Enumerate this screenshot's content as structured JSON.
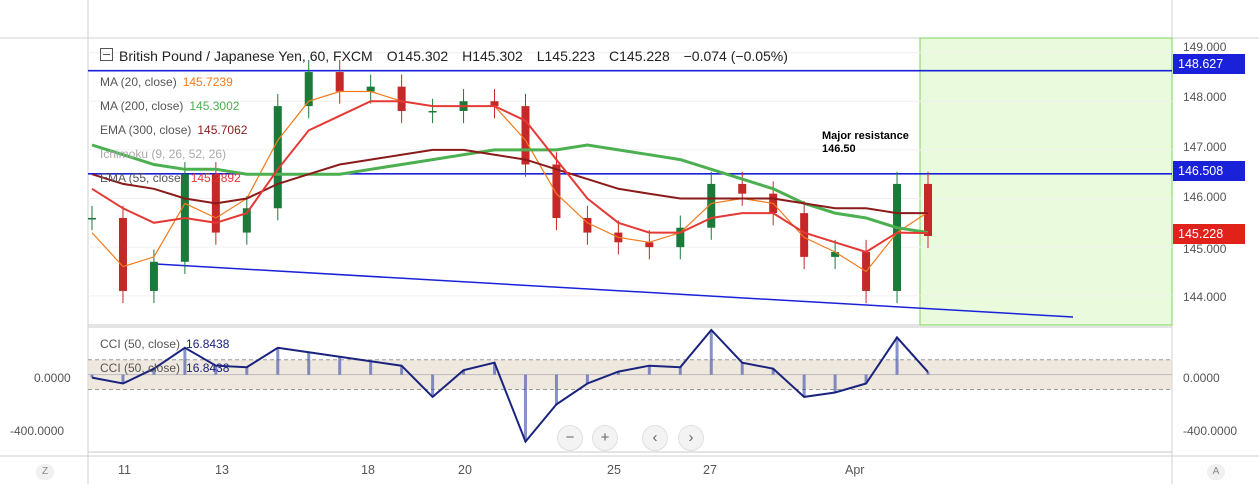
{
  "header": {
    "symbol": "British Pound / Japanese Yen, 60, FXCM",
    "open": "O145.302",
    "high": "H145.302",
    "low": "L145.223",
    "close": "C145.228",
    "change": "−0.074 (−0.05%)"
  },
  "indicators": [
    {
      "label": "MA (20, close)",
      "value": "145.7239",
      "color": "#f07b1c"
    },
    {
      "label": "MA (200, close)",
      "value": "145.3002",
      "color": "#4caf50"
    },
    {
      "label": "EMA (300, close)",
      "value": "145.7062",
      "color": "#8b1a1a"
    },
    {
      "label": "Ichimoku (9, 26, 52, 26)",
      "value": "",
      "color": "#aaaaaa"
    },
    {
      "label": "EMA (55, close)",
      "value": "145.2892",
      "color": "#e53935"
    }
  ],
  "cci_indicators": [
    {
      "label": "CCI (50, close)",
      "value": "16.8438",
      "color": "#1a237e"
    },
    {
      "label": "CCI (50, close)",
      "value": "16.8438",
      "color": "#1a237e"
    }
  ],
  "price_tags": {
    "upper": "148.627",
    "resistance": "146.508",
    "last": "145.228"
  },
  "annotation": {
    "line1": "Major resistance",
    "line2": "146.50"
  },
  "axis": {
    "price_ticks": [
      "149.000",
      "148.000",
      "147.000",
      "146.000",
      "145.000",
      "144.000"
    ],
    "cci_ticks": [
      "0.0000",
      "-400.0000"
    ],
    "dates": [
      "11",
      "13",
      "18",
      "20",
      "25",
      "27",
      "Apr"
    ]
  },
  "controls": {
    "zoom_out": "−",
    "zoom_in": "+",
    "scroll_left": "‹",
    "scroll_right": "›",
    "left_corner": "Z",
    "right_corner": "A"
  },
  "colors": {
    "up": "#1b7a3a",
    "down": "#c62828",
    "blue_line": "#1a22d9",
    "forecast_zone": "#e9fbdc",
    "cci_band": "#e8ded0"
  },
  "chart_data": {
    "type": "line",
    "title": "British Pound / Japanese Yen, 60, FXCM",
    "x": [
      "11",
      "11.5",
      "12",
      "12.5",
      "13",
      "13.5",
      "14",
      "14.5",
      "15",
      "18",
      "18.5",
      "19",
      "19.5",
      "20",
      "20.5",
      "21",
      "22",
      "25",
      "25.5",
      "26",
      "26.5",
      "27",
      "27.5",
      "28",
      "28.5",
      "29",
      "Apr 1",
      "Apr 1.5"
    ],
    "series": [
      {
        "name": "Price (close)",
        "values": [
          145.6,
          144.1,
          144.7,
          146.5,
          145.3,
          145.8,
          147.9,
          148.6,
          148.2,
          148.3,
          147.8,
          147.8,
          148.0,
          147.9,
          146.7,
          145.6,
          145.3,
          145.1,
          145.0,
          145.4,
          146.3,
          146.1,
          145.7,
          144.8,
          144.9,
          144.1,
          146.3,
          145.23
        ]
      },
      {
        "name": "MA (20, close)",
        "values": [
          145.3,
          144.6,
          144.8,
          145.9,
          145.6,
          146.0,
          147.2,
          148.0,
          148.2,
          148.2,
          148.0,
          147.9,
          147.9,
          147.9,
          147.2,
          146.1,
          145.5,
          145.2,
          145.1,
          145.3,
          145.9,
          146.0,
          145.9,
          145.2,
          144.9,
          144.5,
          145.3,
          145.72
        ]
      },
      {
        "name": "MA (200, close)",
        "values": [
          147.1,
          146.9,
          146.7,
          146.6,
          146.6,
          146.5,
          146.5,
          146.5,
          146.5,
          146.6,
          146.7,
          146.8,
          146.9,
          147.0,
          147.0,
          147.0,
          147.1,
          147.0,
          146.9,
          146.8,
          146.6,
          146.4,
          146.2,
          145.9,
          145.7,
          145.6,
          145.4,
          145.3
        ]
      },
      {
        "name": "EMA (300, close)",
        "values": [
          146.5,
          146.3,
          146.2,
          146.0,
          145.9,
          146.0,
          146.3,
          146.5,
          146.7,
          146.8,
          146.9,
          147.0,
          147.0,
          146.9,
          146.8,
          146.6,
          146.4,
          146.2,
          146.1,
          146.0,
          146.0,
          146.0,
          146.0,
          145.9,
          145.8,
          145.8,
          145.7,
          145.7
        ]
      },
      {
        "name": "EMA (55, close)",
        "values": [
          146.2,
          145.8,
          145.5,
          145.6,
          145.5,
          145.7,
          146.6,
          147.4,
          147.7,
          148.0,
          148.0,
          147.9,
          147.9,
          147.9,
          147.6,
          146.8,
          146.0,
          145.5,
          145.3,
          145.3,
          145.6,
          145.7,
          145.7,
          145.3,
          145.1,
          144.9,
          145.3,
          145.29
        ]
      }
    ],
    "levels": [
      148.627,
      146.508
    ],
    "last_price": 145.228,
    "ylim": [
      143.4,
      149.3
    ],
    "cci": {
      "name": "CCI (50, close)",
      "values": [
        -20,
        -60,
        40,
        180,
        60,
        50,
        180,
        150,
        120,
        90,
        60,
        -150,
        30,
        80,
        -450,
        -200,
        -60,
        20,
        60,
        50,
        300,
        80,
        40,
        -150,
        -120,
        -60,
        250,
        17
      ],
      "ylim": [
        -520,
        320
      ],
      "band": [
        -100,
        100
      ]
    }
  }
}
